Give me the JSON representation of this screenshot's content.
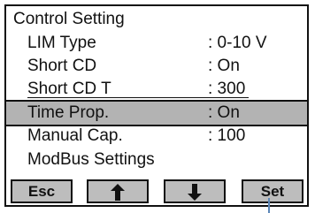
{
  "title": "Control Setting",
  "menu": [
    {
      "label": "LIM Type",
      "value": ": 0-10 V"
    },
    {
      "label": "Short CD",
      "value": ": On"
    },
    {
      "label": "Short CD T",
      "value": ": 300"
    },
    {
      "label": "Time Prop.",
      "value": ": On",
      "selected": true
    },
    {
      "label": "Manual Cap.",
      "value": ": 100"
    },
    {
      "label": "ModBus Settings",
      "value": ""
    }
  ],
  "buttons": {
    "esc": "Esc",
    "up_icon": "arrow-up-icon",
    "down_icon": "arrow-down-icon",
    "set": "Set"
  },
  "colors": {
    "selection": "#b3b3b3",
    "button": "#bdbdbd",
    "border": "#111111",
    "pointer_line": "#5b86b8"
  }
}
